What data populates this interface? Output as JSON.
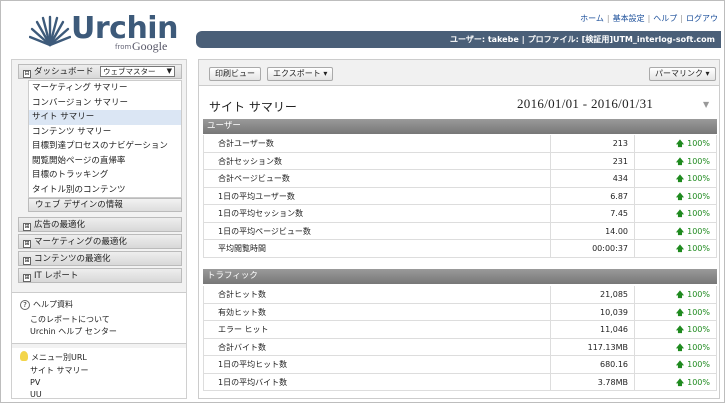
{
  "logo": {
    "word": "Urchin",
    "from": "from",
    "google": "Google"
  },
  "topnav": {
    "items": [
      "ホーム",
      "基本設定",
      "ヘルプ",
      "ログアウ"
    ]
  },
  "userbar": {
    "user": "ユーザー: takebe",
    "profile": "プロファイル: [検証用]UTM_interlog-soft.com"
  },
  "sidebar": {
    "dashboard": {
      "label": "ダッシュボード",
      "select": "ウェブマスター"
    },
    "dashboard_items": [
      "マーケティング サマリー",
      "コンバージョン サマリー",
      "サイト サマリー",
      "コンテンツ サマリー",
      "目標到達プロセスのナビゲーション",
      "閲覧開始ページの直帰率",
      "目標のトラッキング",
      "タイトル別のコンテンツ"
    ],
    "web_design": "ウェブ デザインの情報",
    "sections": [
      "広告の最適化",
      "マーケティングの最適化",
      "コンテンツの最適化",
      "IT レポート"
    ],
    "help": {
      "title": "ヘルプ資料",
      "links": [
        "このレポートについて",
        "Urchin ヘルプ センター"
      ]
    },
    "menu_url": {
      "title": "メニュー別URL",
      "links": [
        "サイト サマリー",
        "PV",
        "UU"
      ]
    }
  },
  "toolbar": {
    "print": "印刷ビュー",
    "export": "エクスポート",
    "permalink": "パーマリンク"
  },
  "page": {
    "title": "サイト サマリー",
    "date_range": "2016/01/01 - 2016/01/31"
  },
  "users_section": {
    "header": "ユーザー",
    "rows": [
      {
        "label": "合計ユーザー数",
        "value": "213",
        "pct": "100%"
      },
      {
        "label": "合計セッション数",
        "value": "231",
        "pct": "100%"
      },
      {
        "label": "合計ページビュー数",
        "value": "434",
        "pct": "100%"
      },
      {
        "label": "1日の平均ユーザー数",
        "value": "6.87",
        "pct": "100%"
      },
      {
        "label": "1日の平均セッション数",
        "value": "7.45",
        "pct": "100%"
      },
      {
        "label": "1日の平均ページビュー数",
        "value": "14.00",
        "pct": "100%"
      },
      {
        "label": "平均閲覧時間",
        "value": "00:00:37",
        "pct": "100%"
      }
    ]
  },
  "traffic_section": {
    "header": "トラフィック",
    "rows": [
      {
        "label": "合計ヒット数",
        "value": "21,085",
        "pct": "100%"
      },
      {
        "label": "有効ヒット数",
        "value": "10,039",
        "pct": "100%"
      },
      {
        "label": "エラー ヒット",
        "value": "11,046",
        "pct": "100%"
      },
      {
        "label": "合計バイト数",
        "value": "117.13MB",
        "pct": "100%"
      },
      {
        "label": "1日の平均ヒット数",
        "value": "680.16",
        "pct": "100%"
      },
      {
        "label": "1日の平均バイト数",
        "value": "3.78MB",
        "pct": "100%"
      }
    ]
  },
  "colors": {
    "userbar": "#4a5f78",
    "logo": "#3d5a7a",
    "up_arrow": "#1f8a1f",
    "section_header": "#888888"
  }
}
